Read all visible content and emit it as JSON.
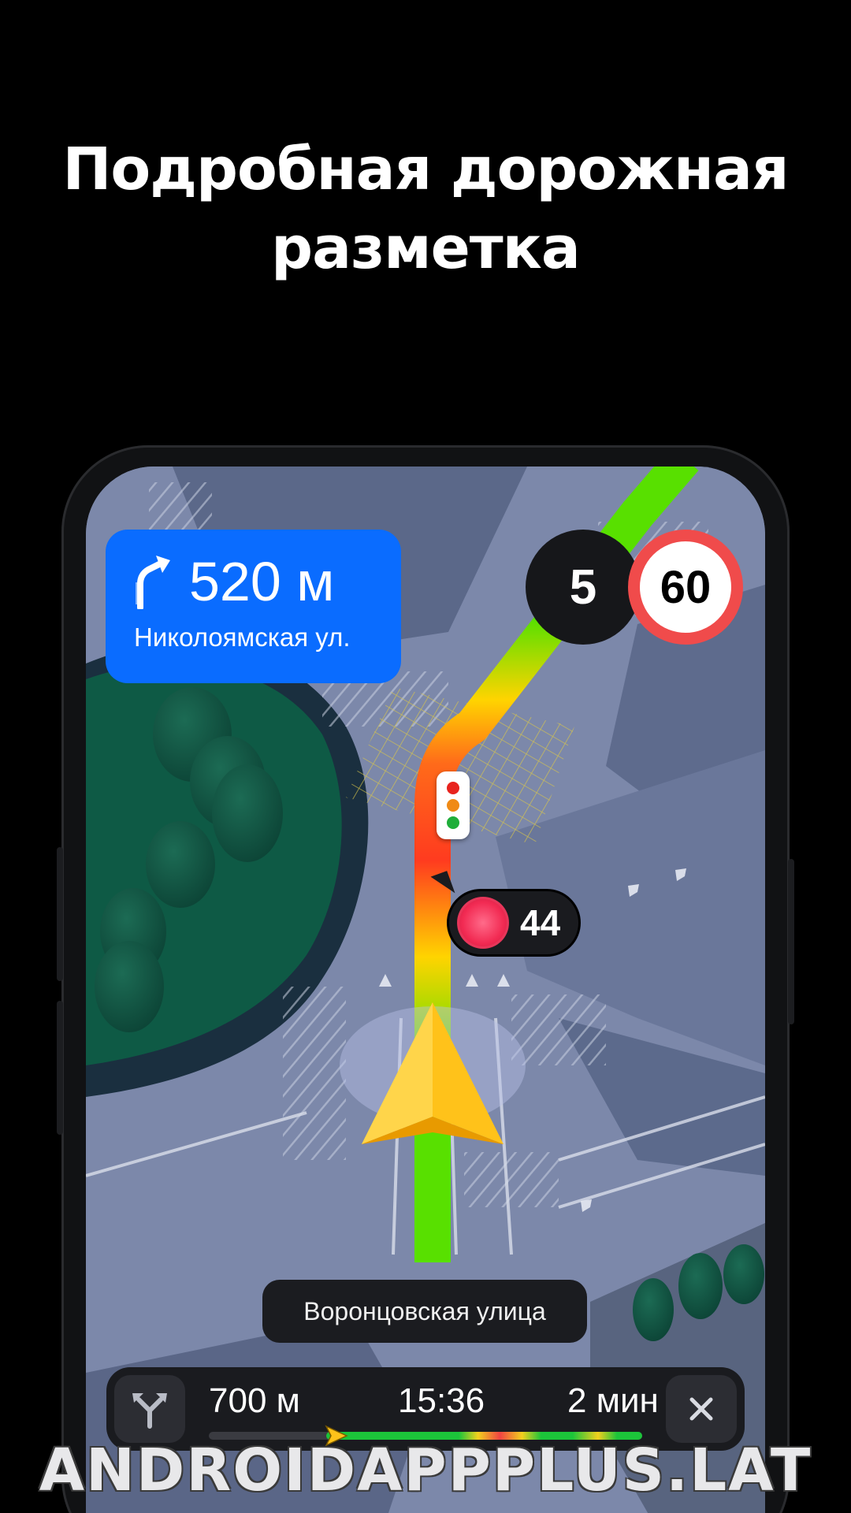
{
  "headline": {
    "line1": "Подробная дорожная",
    "line2": "разметка"
  },
  "maneuver": {
    "icon": "turn-right-icon",
    "distance": "520 м",
    "street": "Николоямская ул."
  },
  "speed": {
    "current": "5",
    "limit": "60"
  },
  "traffic_light": {
    "icon": "traffic-light-icon",
    "countdown": "44"
  },
  "current_street": "Воронцовская улица",
  "bottom_bar": {
    "route_icon": "route-fork-icon",
    "distance": "700 м",
    "arrival_time": "15:36",
    "duration": "2 мин",
    "close_icon": "close-icon",
    "progress": 0.27
  },
  "watermark": "ANDROIDAPPPLUS.LAT",
  "colors": {
    "maneuver_bg": "#0a6cff",
    "route_green": "#58e000",
    "route_red": "#ff3b1f",
    "limit_ring": "#f04b4b",
    "user_arrow": "#ffc21a"
  }
}
